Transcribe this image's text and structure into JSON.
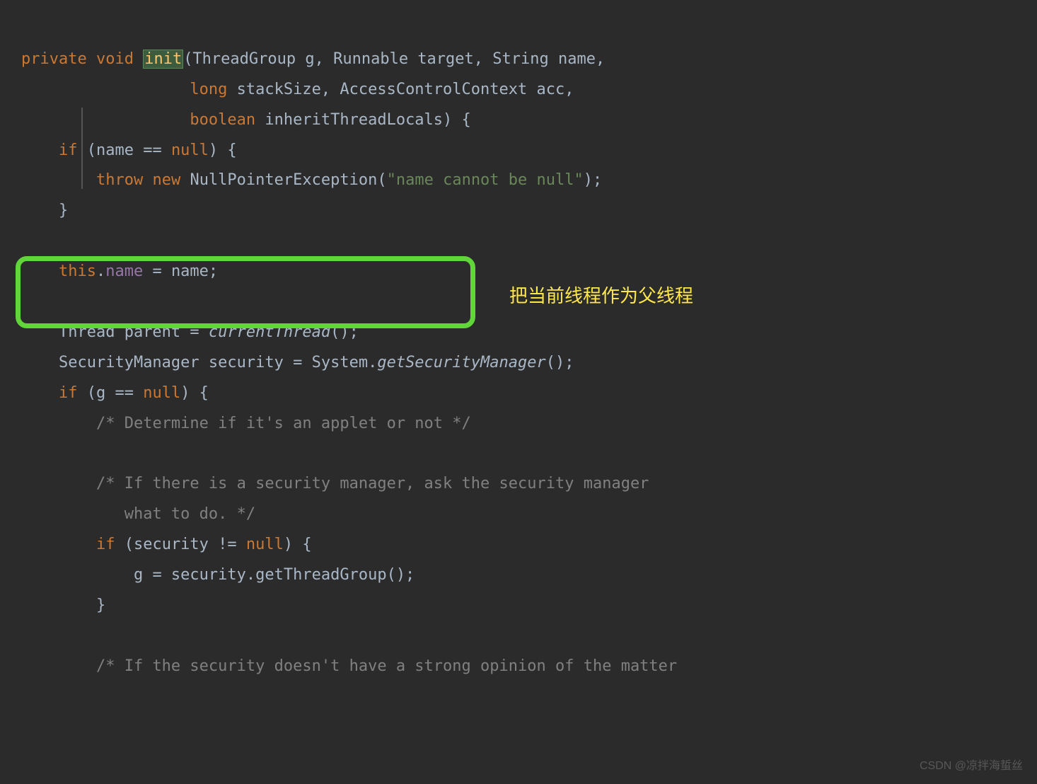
{
  "code": {
    "l1": {
      "kw1": "private",
      "kw2": "void",
      "method": "init",
      "sig1": "(ThreadGroup g, Runnable target, String name,"
    },
    "l2": {
      "kw": "long",
      "rest": " stackSize, AccessControlContext acc,"
    },
    "l3": {
      "kw": "boolean",
      "rest": " inheritThreadLocals) {"
    },
    "l4": {
      "kw": "if",
      "rest1": " (name == ",
      "null": "null",
      "rest2": ") {"
    },
    "l5": {
      "kw1": "throw",
      "kw2": "new",
      "rest1": " NullPointerException(",
      "str": "\"name cannot be null\"",
      "rest2": ");"
    },
    "l6": "}",
    "l8": {
      "kw": "this",
      "dot": ".",
      "field": "name",
      "rest": " = name;"
    },
    "l10": {
      "rest1": "Thread parent = ",
      "method": "currentThread",
      "rest2": "();"
    },
    "l11": {
      "rest1": "SecurityManager security = System.",
      "method": "getSecurityManager",
      "rest2": "();"
    },
    "l12": {
      "kw": "if",
      "rest1": " (g == ",
      "null": "null",
      "rest2": ") {"
    },
    "l13": "/* Determine if it's an applet or not */",
    "l15": "/* If there is a security manager, ask the security manager",
    "l16": "   what to do. */",
    "l17": {
      "kw": "if",
      "rest1": " (security != ",
      "null": "null",
      "rest2": ") {"
    },
    "l18": "g = security.getThreadGroup();",
    "l19": "}",
    "l21": "/* If the security doesn't have a strong opinion of the matter"
  },
  "annotation": "把当前线程作为父线程",
  "watermark": "CSDN @凉拌海蜇丝"
}
